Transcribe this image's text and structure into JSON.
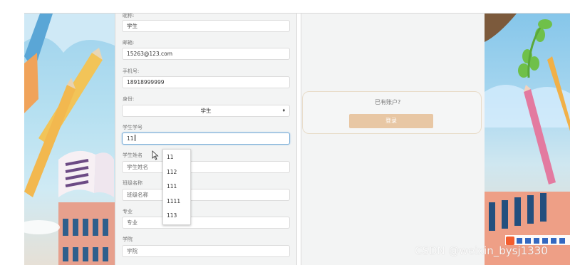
{
  "form": {
    "fields": [
      {
        "label": "昵称:",
        "value": "学生",
        "placeholder": ""
      },
      {
        "label": "邮箱:",
        "value": "15263@123.com",
        "placeholder": ""
      },
      {
        "label": "手机号:",
        "value": "18918999999",
        "placeholder": ""
      },
      {
        "label": "身份:",
        "value": "学生",
        "placeholder": ""
      },
      {
        "label": "学生学号",
        "value": "11",
        "placeholder": ""
      },
      {
        "label": "学生姓名",
        "value": "",
        "placeholder": "学生姓名"
      },
      {
        "label": "班级名称",
        "value": "",
        "placeholder": "班级名称"
      },
      {
        "label": "专业",
        "value": "",
        "placeholder": "专业"
      },
      {
        "label": "学院",
        "value": "",
        "placeholder": "学院"
      }
    ],
    "autocomplete_options": [
      "11",
      "112",
      "111",
      "1111",
      "113"
    ]
  },
  "login": {
    "question": "已有账户?",
    "button_label": "登录"
  },
  "watermark": "CSDN @weixin_bysj1330",
  "colors": {
    "login_button": "#e8c7a4",
    "focus_border": "#7aaed8",
    "panel_bg": "#f3f4f4"
  },
  "icons": [
    "mouse-cursor-icon",
    "select-arrow-icon",
    "sogou-ime-icon"
  ]
}
